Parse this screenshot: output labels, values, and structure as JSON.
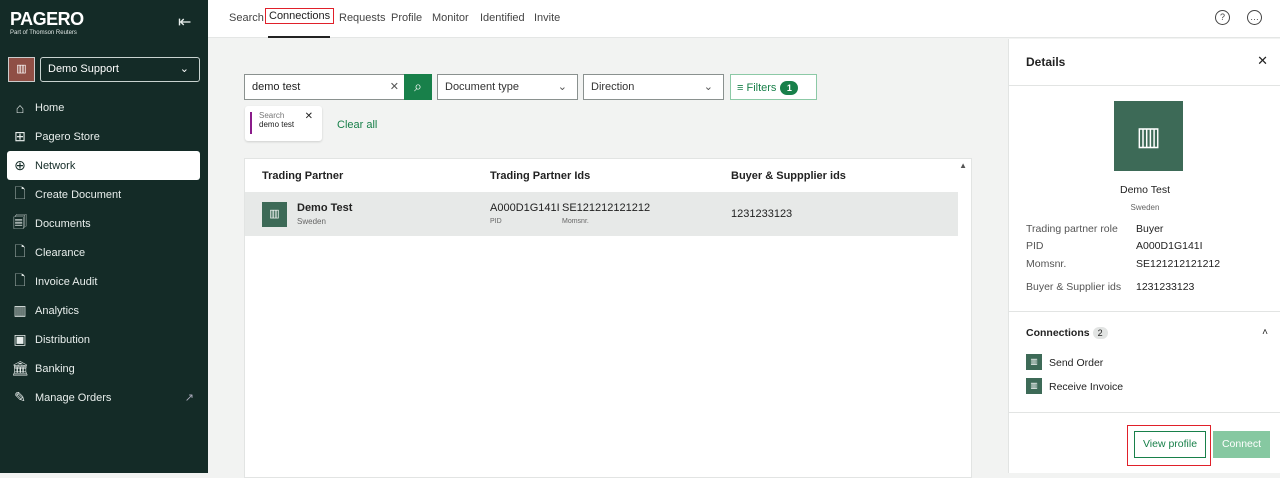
{
  "brand": {
    "logo": "PAGERO",
    "sub": "Part of Thomson Reuters"
  },
  "org": {
    "name": "Demo Support"
  },
  "nav": [
    {
      "label": "Home",
      "icon": "home-icon"
    },
    {
      "label": "Pagero Store",
      "icon": "store-icon"
    },
    {
      "label": "Network",
      "icon": "globe-icon"
    },
    {
      "label": "Create Document",
      "icon": "create-document-icon"
    },
    {
      "label": "Documents",
      "icon": "documents-icon"
    },
    {
      "label": "Clearance",
      "icon": "clearance-icon"
    },
    {
      "label": "Invoice Audit",
      "icon": "invoice-audit-icon"
    },
    {
      "label": "Analytics",
      "icon": "analytics-icon"
    },
    {
      "label": "Distribution",
      "icon": "distribution-icon"
    },
    {
      "label": "Banking",
      "icon": "bank-icon"
    },
    {
      "label": "Manage Orders",
      "icon": "manage-orders-icon"
    }
  ],
  "tabs": [
    "Search",
    "Connections",
    "Requests",
    "Profile",
    "Monitor",
    "Identified",
    "Invite"
  ],
  "search": {
    "value": "demo test"
  },
  "filters": {
    "document_type": "Document type",
    "direction": "Direction",
    "filters_label": "Filters",
    "filters_count": "1"
  },
  "chip": {
    "key": "Search",
    "value": "demo test"
  },
  "clear_all": "Clear all",
  "table": {
    "headers": [
      "Trading Partner",
      "Trading Partner Ids",
      "Buyer & Suppplier ids"
    ],
    "rows": [
      {
        "name": "Demo Test",
        "country": "Sweden",
        "pid": "A000D1G141I",
        "pid_label": "PID",
        "momsnr": "SE121212121212",
        "momsnr_label": "Momsnr.",
        "buyer_ids": "1231233123"
      }
    ]
  },
  "details": {
    "title": "Details",
    "name": "Demo Test",
    "country": "Sweden",
    "fields": [
      {
        "k": "Trading partner role",
        "v": "Buyer"
      },
      {
        "k": "PID",
        "v": "A000D1G141I"
      },
      {
        "k": "Momsnr.",
        "v": "SE121212121212"
      },
      {
        "k": "Buyer & Supplier ids",
        "v": "1231233123"
      }
    ],
    "connections_label": "Connections",
    "connections_count": "2",
    "connections": [
      "Send Order",
      "Receive Invoice"
    ],
    "view_profile": "View profile",
    "connect": "Connect"
  }
}
